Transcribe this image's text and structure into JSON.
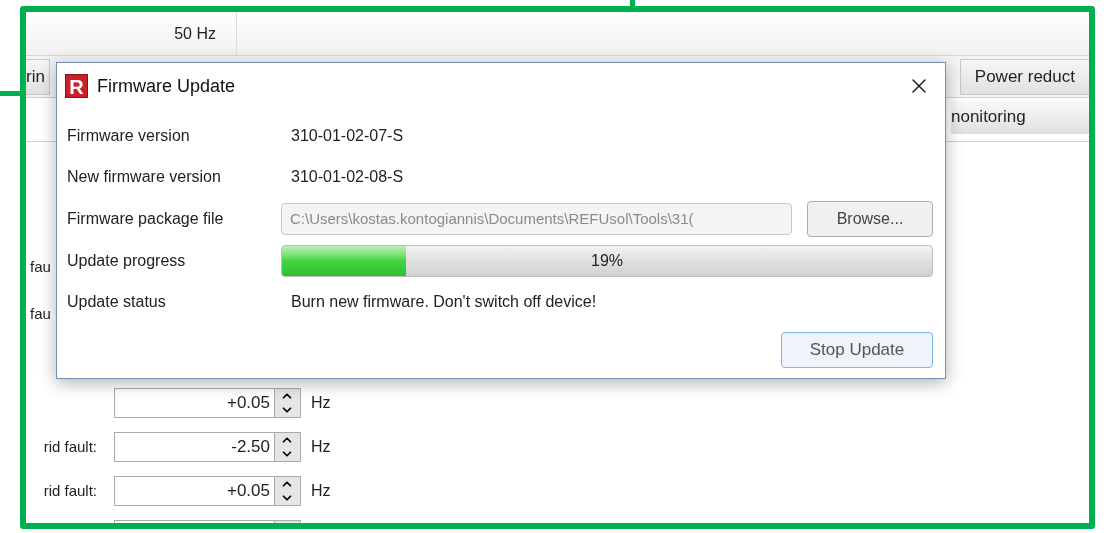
{
  "background": {
    "frequency_cell": "50 Hz",
    "tabs": [
      {
        "label": "rin",
        "selected": false
      },
      {
        "label": "Power reduct",
        "selected": false
      }
    ],
    "subtab": "nonitoring",
    "partial_labels": [
      "fau",
      "fau"
    ],
    "spinners": [
      {
        "kind": "field",
        "value": "+0.05",
        "unit": "Hz"
      },
      {
        "kind": "field",
        "label": "rid fault:",
        "value": "-2.50",
        "unit": "Hz"
      },
      {
        "kind": "field",
        "label": "rid fault:",
        "value": "+0.05",
        "unit": "Hz"
      },
      {
        "kind": "cut"
      }
    ]
  },
  "dialog": {
    "logo_letter": "R",
    "title": "Firmware Update",
    "rows": [
      {
        "kind": "text",
        "label": "Firmware version",
        "value": "310-01-02-07-S"
      },
      {
        "kind": "text",
        "label": "New firmware version",
        "value": "310-01-02-08-S"
      },
      {
        "kind": "file",
        "label": "Firmware package file",
        "value": "C:\\Users\\kostas.kontogiannis\\Documents\\REFUsol\\Tools\\31(",
        "disabled": true,
        "button": "Browse..."
      },
      {
        "kind": "progress",
        "label": "Update progress",
        "level": 0.19,
        "reading": "19%"
      },
      {
        "kind": "text",
        "label": "Update status",
        "value": "Burn new firmware. Don't switch off device!"
      }
    ],
    "button": "Stop Update"
  }
}
